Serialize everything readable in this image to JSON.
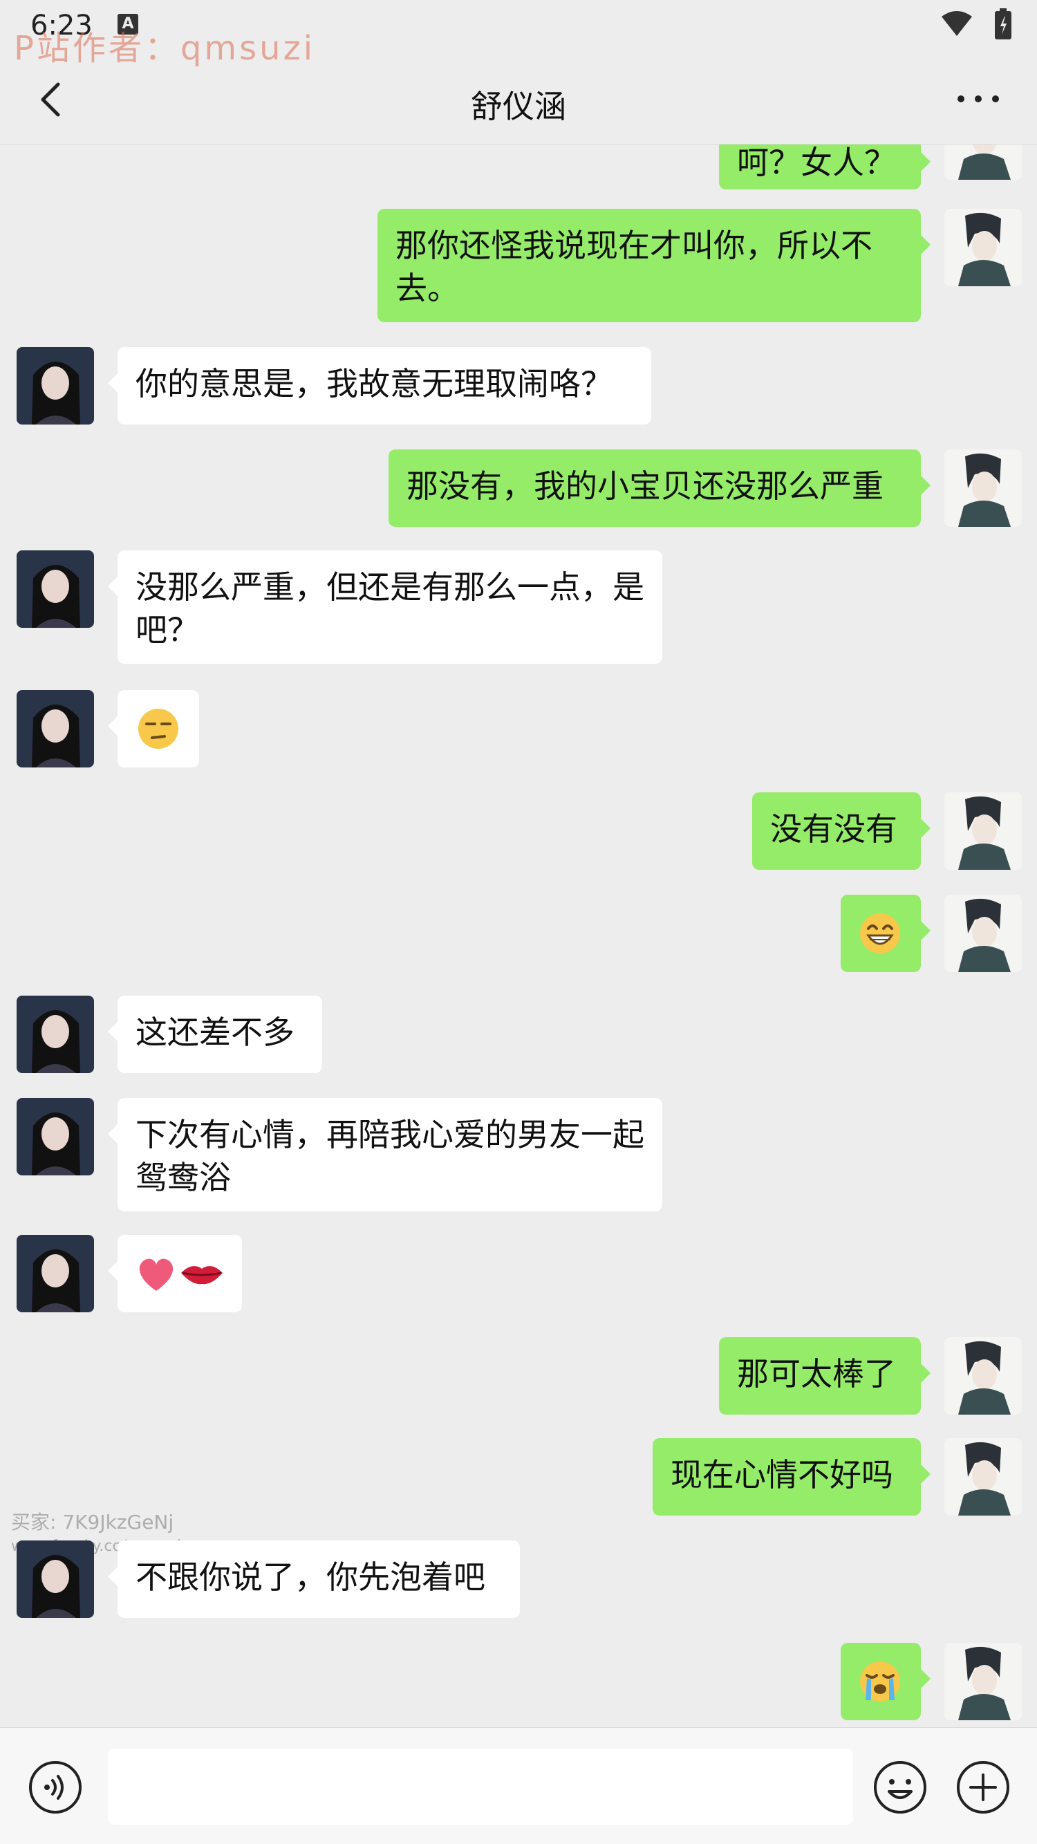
{
  "status_bar": {
    "time": "6:23",
    "a_badge": "A",
    "watermark": "P站作者：qmsuzi"
  },
  "header": {
    "title": "舒仪涵",
    "back_icon": "chevron-left-icon",
    "more_icon": "more-dots-icon"
  },
  "messages": [
    {
      "side": "out",
      "type": "text",
      "text": "呵？女人？"
    },
    {
      "side": "out",
      "type": "text",
      "text": "那你还怪我说现在才叫你，所以不去。"
    },
    {
      "side": "in",
      "type": "text",
      "text": "你的意思是，我故意无理取闹咯？"
    },
    {
      "side": "out",
      "type": "text",
      "text": "那没有，我的小宝贝还没那么严重"
    },
    {
      "side": "in",
      "type": "text",
      "text": "没那么严重，但还是有那么一点，是吧？"
    },
    {
      "side": "in",
      "type": "emoji",
      "emoji": "smirk-face-icon"
    },
    {
      "side": "out",
      "type": "text",
      "text": "没有没有"
    },
    {
      "side": "out",
      "type": "emoji",
      "emoji": "grin-face-icon"
    },
    {
      "side": "in",
      "type": "text",
      "text": "这还差不多"
    },
    {
      "side": "in",
      "type": "text",
      "text": "下次有心情，再陪我心爱的男友一起鸳鸯浴"
    },
    {
      "side": "in",
      "type": "emoji",
      "emoji": "heart-lips-icon"
    },
    {
      "side": "out",
      "type": "text",
      "text": "那可太棒了"
    },
    {
      "side": "out",
      "type": "text",
      "text": "现在心情不好吗"
    },
    {
      "side": "in",
      "type": "text",
      "text": "不跟你说了，你先泡着吧"
    },
    {
      "side": "out",
      "type": "emoji",
      "emoji": "crying-face-icon"
    }
  ],
  "watermark_overlay": {
    "buyer": "买家: 7K9JkzGeNj",
    "url": "www.fansky.co/qmsuzi"
  },
  "input_bar": {
    "voice_icon": "voice-icon",
    "emoji_icon": "emoji-icon",
    "plus_icon": "plus-icon"
  },
  "colors": {
    "background": "#ededed",
    "outgoing_bubble": "#95ec69",
    "incoming_bubble": "#ffffff"
  }
}
